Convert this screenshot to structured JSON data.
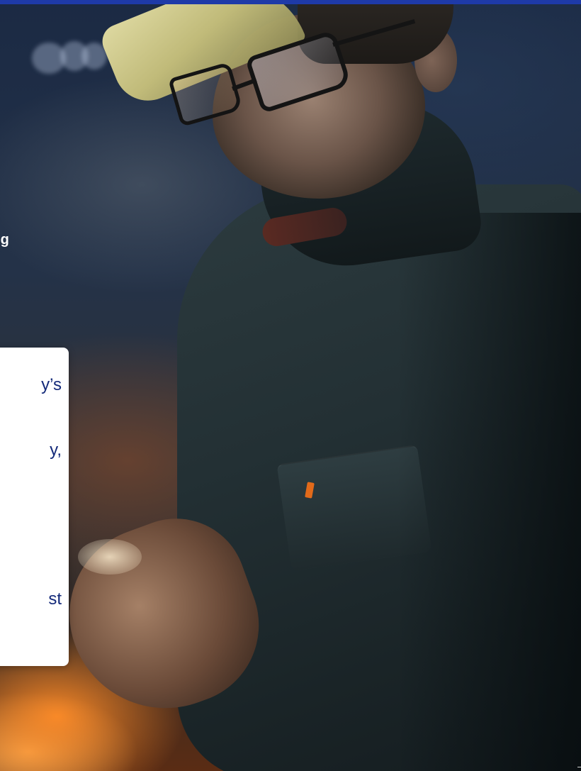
{
  "hero": {
    "image_alt": "Industrial worker in hard hat and glasses looking at a tablet",
    "heading_fragment": "aining"
  },
  "card": {
    "lines": [
      "y’s",
      "y,",
      "st"
    ]
  },
  "colors": {
    "top_bar": "#1e3aa8",
    "card_background": "#ffffff",
    "card_text": "#142a7a",
    "heading_text": "#ffffff"
  }
}
